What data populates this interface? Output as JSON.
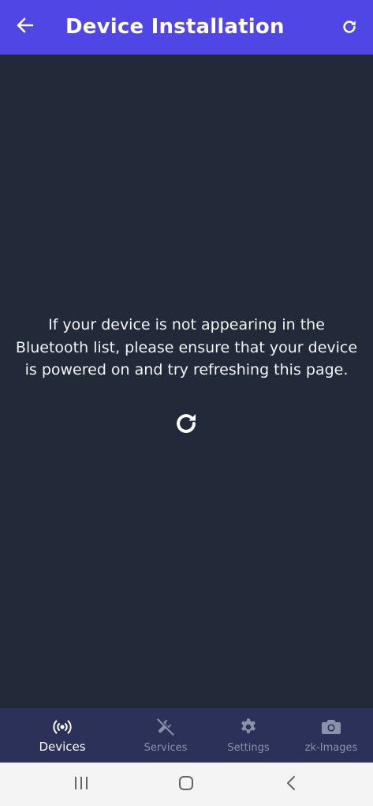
{
  "app_bar": {
    "title": "Device Installation",
    "back_icon": "arrow-left-icon",
    "refresh_icon": "refresh-icon",
    "background_color": "#4f46e5"
  },
  "main": {
    "message": "If your device is not appearing in the Bluetooth list, please ensure that your device is powered on and try refreshing this page.",
    "refresh_icon": "refresh-icon"
  },
  "bottom_nav": {
    "background_color": "#2b3159",
    "items": [
      {
        "label": "Devices",
        "icon": "broadcast-icon",
        "active": true
      },
      {
        "label": "Services",
        "icon": "wrench-off-icon",
        "active": false
      },
      {
        "label": "Settings",
        "icon": "gear-icon",
        "active": false
      },
      {
        "label": "zk-Images",
        "icon": "camera-icon",
        "active": false
      }
    ]
  },
  "system_nav": {
    "recents_icon": "recents-icon",
    "home_icon": "home-icon",
    "back_icon": "chevron-left-icon"
  }
}
